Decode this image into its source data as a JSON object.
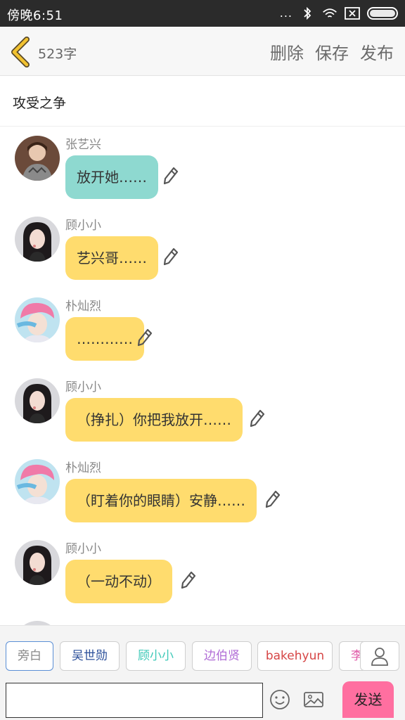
{
  "status_bar": {
    "time": "傍晚6:51",
    "dots": "..."
  },
  "header": {
    "word_count": "523字",
    "delete_label": "删除",
    "save_label": "保存",
    "publish_label": "发布"
  },
  "story": {
    "title": "攻受之争"
  },
  "messages": [
    {
      "name": "张艺兴",
      "text": "放开她……",
      "bubble_color": "#8ed9d0"
    },
    {
      "name": "顾小小",
      "text": "艺兴哥……",
      "bubble_color": "#ffdc6e"
    },
    {
      "name": "朴灿烈",
      "text": "…………",
      "bubble_color": "#ffdc6e"
    },
    {
      "name": "顾小小",
      "text": "（挣扎）你把我放开……",
      "bubble_color": "#ffdc6e"
    },
    {
      "name": "朴灿烈",
      "text": "（盯着你的眼睛）安静……",
      "bubble_color": "#ffdc6e"
    },
    {
      "name": "顾小小",
      "text": "（一动不动）",
      "bubble_color": "#ffdc6e"
    }
  ],
  "characters": [
    {
      "label": "旁白",
      "color": "#888888"
    },
    {
      "label": "吴世勋",
      "color": "#2b4f9a"
    },
    {
      "label": "顾小小",
      "color": "#3fc9b8"
    },
    {
      "label": "边伯贤",
      "color": "#b06cd6"
    },
    {
      "label": "bakehyun",
      "color": "#d64545"
    },
    {
      "label": "李",
      "color": "#e05ba8"
    }
  ],
  "composer": {
    "input_value": "",
    "send_label": "发送"
  },
  "colors": {
    "accent_yellow": "#f2c230",
    "send_button": "#ff6fa0",
    "bubble_teal": "#8ed9d0",
    "bubble_yellow": "#ffdc6e"
  }
}
